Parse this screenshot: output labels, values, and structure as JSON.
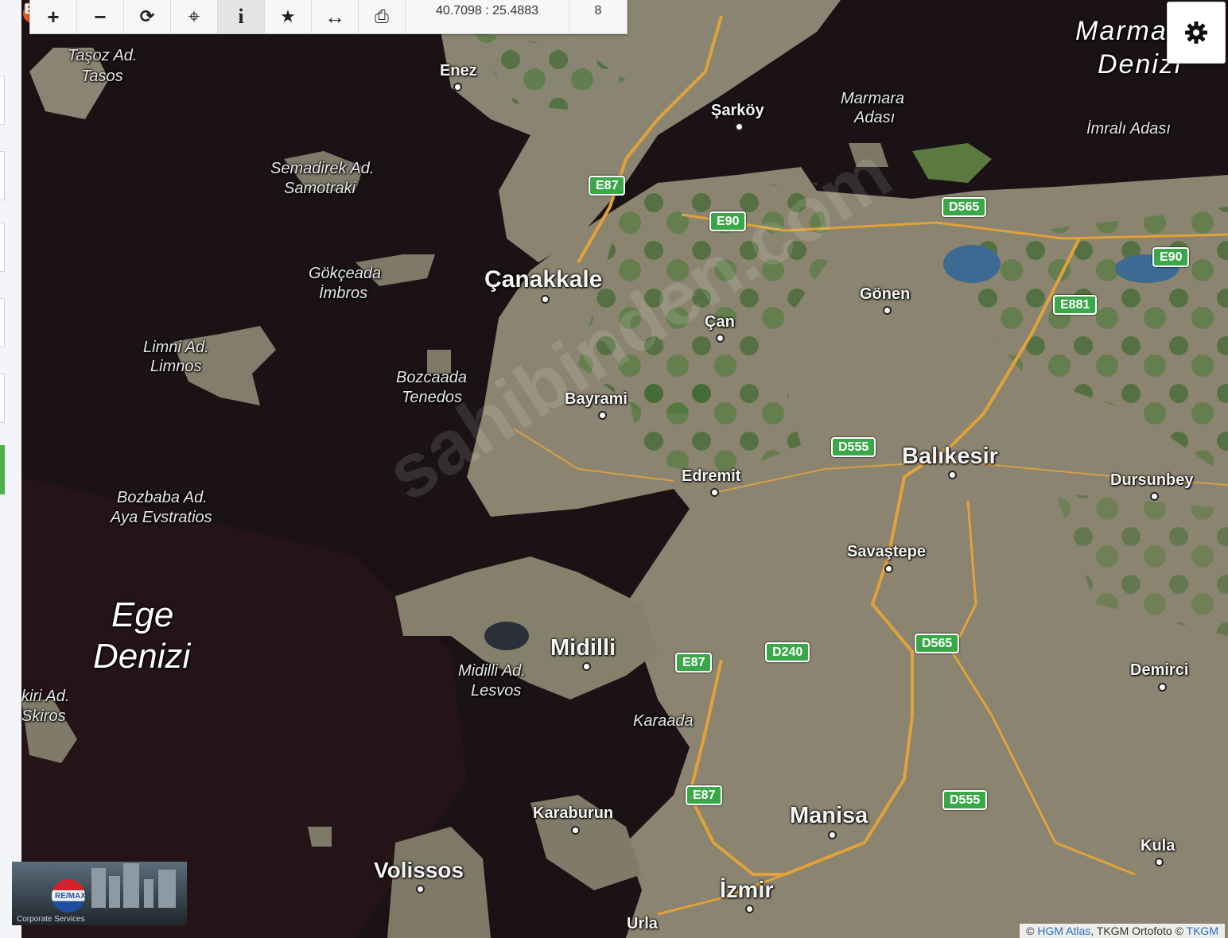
{
  "toolbar": {
    "buttons": [
      {
        "name": "zoom-in-button",
        "icon": "plus-icon",
        "glyph": "+"
      },
      {
        "name": "zoom-out-button",
        "icon": "minus-icon",
        "glyph": "−"
      },
      {
        "name": "refresh-button",
        "icon": "refresh-icon",
        "glyph": "⟳"
      },
      {
        "name": "locate-button",
        "icon": "crosshair-icon",
        "glyph": "⌖"
      },
      {
        "name": "info-button",
        "icon": "info-icon",
        "glyph": "i"
      },
      {
        "name": "favorite-button",
        "icon": "star-icon",
        "glyph": "★"
      },
      {
        "name": "measure-button",
        "icon": "horizontal-arrows-icon",
        "glyph": "↔"
      },
      {
        "name": "print-button",
        "icon": "printer-icon",
        "glyph": "⎙"
      }
    ],
    "coordinates": "40.7098 : 25.4883",
    "zoom_level": "8"
  },
  "settings": {
    "icon": "gear-icon"
  },
  "map": {
    "seas": {
      "aegean_1": "Ege",
      "aegean_2": "Denizi",
      "marmara_1": "Marma",
      "marmara_2": "Denizi"
    },
    "cities": {
      "canakkale": "Çanakkale",
      "balikesir": "Balıkesir",
      "midilli": "Midilli",
      "manisa": "Manisa",
      "izmir": "İzmir",
      "volissos": "Volissos",
      "enez": "Enez",
      "sarkoy": "Şarköy",
      "gonen": "Gönen",
      "can": "Çan",
      "bayrami": "Bayrami",
      "edremit": "Edremit",
      "dursunbey": "Dursunbey",
      "savastepe": "Savaştepe",
      "demirci": "Demirci",
      "karaada": "Karaada",
      "karaburun": "Karaburun",
      "kula": "Kula",
      "urla": "Urla"
    },
    "islands": {
      "tasoz_1": "Taşoz Ad.",
      "tasoz_2": "Tasos",
      "semadirek_1": "Semadirek Ad.",
      "semadirek_2": "Samotraki",
      "gokceada_1": "Gökçeada",
      "gokceada_2": "İmbros",
      "limni_1": "Limni Ad.",
      "limni_2": "Limnos",
      "bozcaada_1": "Bozcaada",
      "bozcaada_2": "Tenedos",
      "bozbaba_1": "Bozbaba Ad.",
      "bozbaba_2": "Aya Evstratios",
      "midilli_1": "Midilli Ad.",
      "midilli_2": "Lesvos",
      "iskiri_1": "kiri Ad.",
      "iskiri_2": "Skiros",
      "marmara_1": "Marmara",
      "marmara_2": "Adası",
      "imrali": "İmralı Adası"
    },
    "roads": [
      "E87",
      "E90",
      "D565",
      "E90",
      "E881",
      "D555",
      "E87",
      "D240",
      "D565",
      "E87",
      "D555"
    ]
  },
  "watermark": "sahibinden.com",
  "logo": {
    "brand": "RE/MAX",
    "sub": "Corporate Services"
  },
  "attribution": {
    "prefix": "© ",
    "hgm": "HGM Atlas",
    "mid": ", TKGM Ortofoto © ",
    "tkgm": "TKGM"
  },
  "colors": {
    "sea": "#1a1214",
    "land": "#8b8470",
    "forest": "#3f6a30",
    "road": "#e0a23a",
    "shield": "#3aa848"
  }
}
